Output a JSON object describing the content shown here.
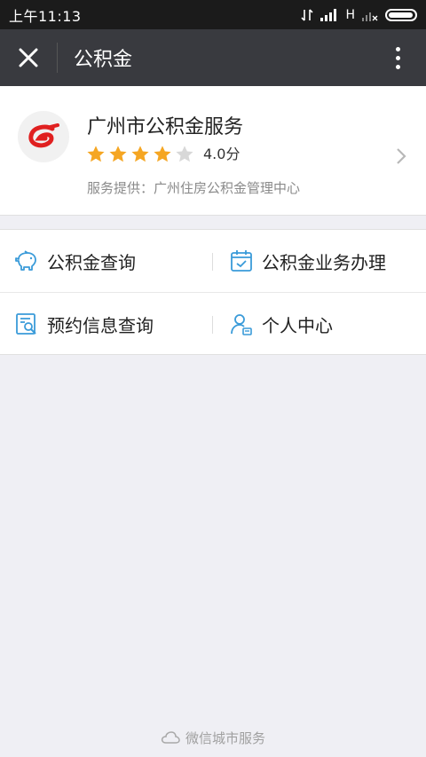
{
  "status_bar": {
    "time": "上午11:13",
    "network": "H"
  },
  "title_bar": {
    "title": "公积金"
  },
  "service": {
    "name": "广州市公积金服务",
    "rating_value": 4.0,
    "rating_text": "4.0分",
    "rating_max": 5,
    "provider": "服务提供：广州住房公积金管理中心"
  },
  "menu": {
    "items": [
      {
        "label": "公积金查询",
        "icon": "piggy-bank-icon"
      },
      {
        "label": "公积金业务办理",
        "icon": "calendar-check-icon"
      },
      {
        "label": "预约信息查询",
        "icon": "document-search-icon"
      },
      {
        "label": "个人中心",
        "icon": "person-icon"
      }
    ]
  },
  "footer": {
    "text": "微信城市服务",
    "icon": "cloud-icon"
  },
  "colors": {
    "title_bar_bg": "#393a3f",
    "status_bar_bg": "#1b1b1b",
    "star_active": "#f5a623",
    "star_inactive": "#d8d8d8",
    "icon_accent": "#3a9bd9",
    "brand_red": "#e02020",
    "page_bg": "#efeff4"
  }
}
